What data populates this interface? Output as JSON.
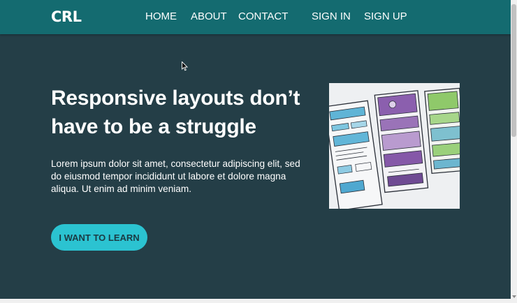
{
  "brand": {
    "logo": "CRL"
  },
  "nav": {
    "home": "HOME",
    "about": "ABOUT",
    "contact": "CONTACT",
    "sign_in": "SIGN IN",
    "sign_up": "SIGN UP"
  },
  "hero": {
    "title": "Responsive layouts don’t have to be a struggle",
    "text": "Lorem ipsum dolor sit amet, consectetur adipiscing elit, sed do eiusmod tempor incididunt ut labore et dolore magna aliqua. Ut enim ad minim veniam.",
    "cta_label": "I WANT TO LEARN",
    "image_icon": "wireframe-sketch-illustration"
  },
  "colors": {
    "navbar": "#146b70",
    "background": "#243e47",
    "accent": "#2bc3d1"
  }
}
